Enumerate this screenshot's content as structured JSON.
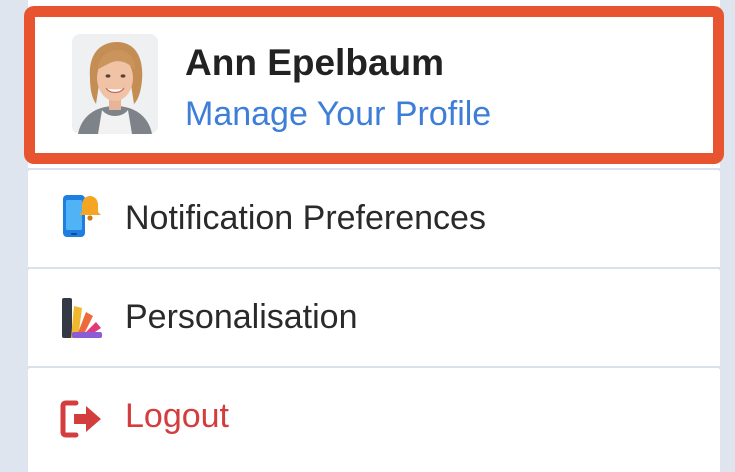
{
  "profile": {
    "name": "Ann Epelbaum",
    "manage_link": "Manage Your Profile"
  },
  "menu": {
    "items": [
      {
        "label": "Notification Preferences",
        "icon": "phone-bell-icon"
      },
      {
        "label": "Personalisation",
        "icon": "color-palette-icon"
      },
      {
        "label": "Logout",
        "icon": "logout-icon"
      }
    ]
  },
  "colors": {
    "highlight": "#e8542f",
    "link": "#3d7ed8",
    "logout": "#d43d3d",
    "text": "#222222"
  }
}
